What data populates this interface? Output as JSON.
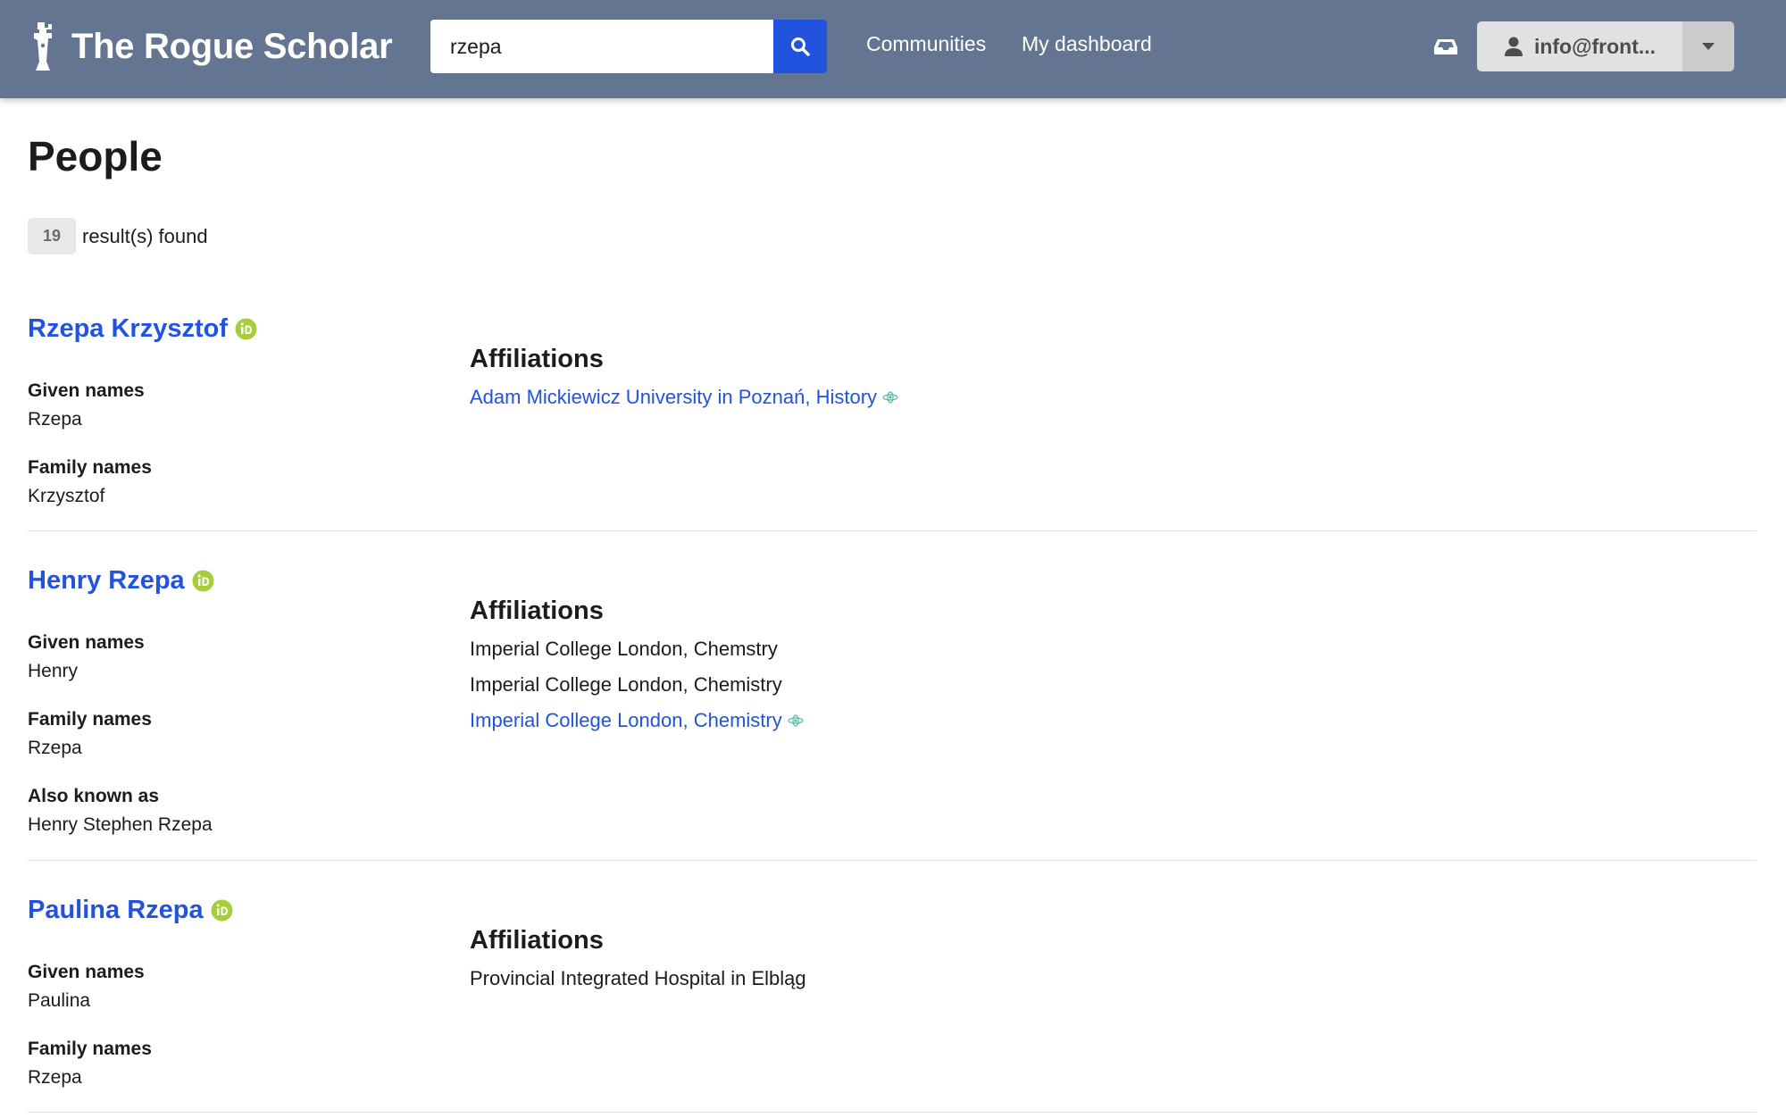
{
  "header": {
    "brand": "The Rogue Scholar",
    "search_value": "rzepa",
    "nav": [
      "Communities",
      "My dashboard"
    ],
    "user_label": "info@front..."
  },
  "page": {
    "title": "People",
    "result_count": "19",
    "result_text": "result(s) found"
  },
  "people": [
    {
      "name": "Rzepa Krzysztof",
      "given_label": "Given names",
      "given": "Rzepa",
      "family_label": "Family names",
      "family": "Krzysztof",
      "aff_label": "Affiliations",
      "affiliations": [
        "Adam Mickiewicz University in Poznań, History"
      ]
    },
    {
      "name": "Henry Rzepa",
      "given_label": "Given names",
      "given": "Henry",
      "family_label": "Family names",
      "family": "Rzepa",
      "aka_label": "Also known as",
      "aka": "Henry Stephen Rzepa",
      "aff_label": "Affiliations",
      "affiliations": [
        "Imperial College London, Chemstry",
        "Imperial College London, Chemistry",
        "Imperial College London, Chemistry"
      ]
    },
    {
      "name": "Paulina Rzepa",
      "given_label": "Given names",
      "given": "Paulina",
      "family_label": "Family names",
      "family": "Rzepa",
      "aff_label": "Affiliations",
      "affiliations": [
        "Provincial Integrated Hospital in Elbląg"
      ]
    }
  ],
  "colors": {
    "header_bg": "#637590",
    "accent": "#2153de",
    "orcid": "#a6ce39",
    "ror": "#53baa1"
  }
}
